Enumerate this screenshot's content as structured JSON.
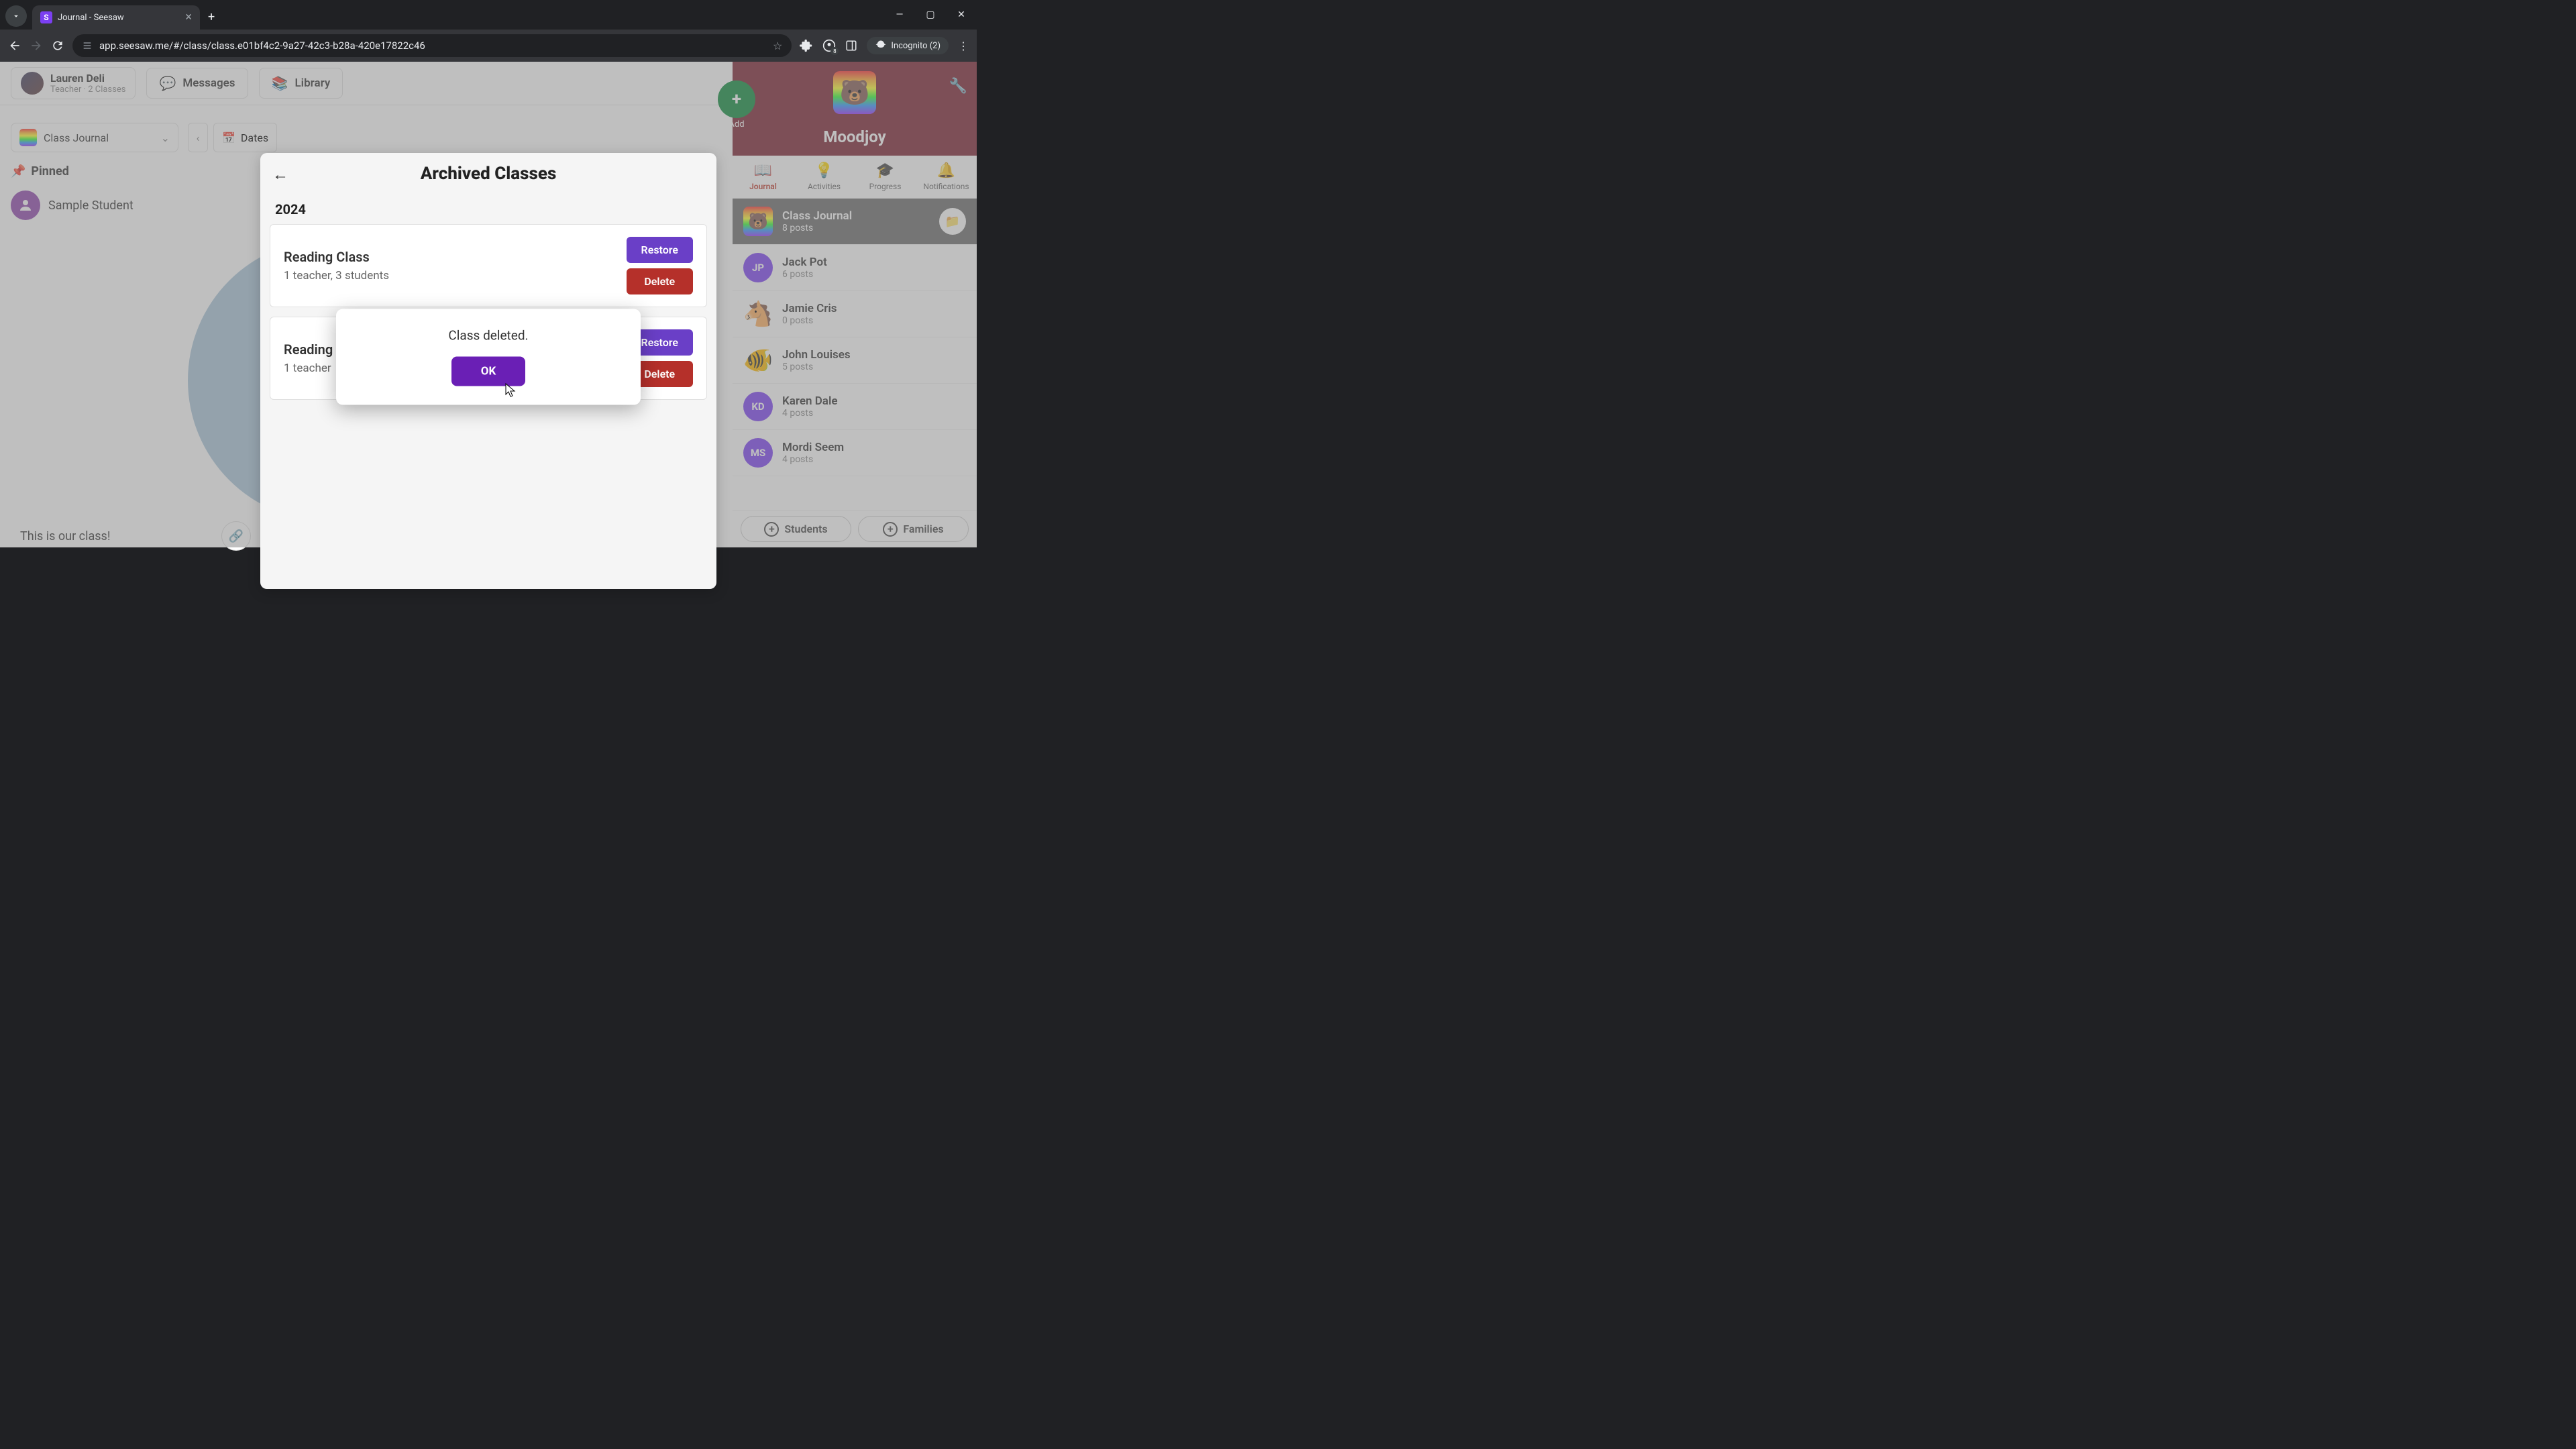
{
  "browser": {
    "tab_title": "Journal - Seesaw",
    "url": "app.seesaw.me/#/class/class.e01bf4c2-9a27-42c3-b28a-420e17822c46",
    "incognito_label": "Incognito (2)"
  },
  "header": {
    "user_name": "Lauren Deli",
    "user_role": "Teacher · 2 Classes",
    "messages_label": "Messages",
    "library_label": "Library"
  },
  "left": {
    "journal_label": "Class Journal",
    "dates_label": "Dates",
    "pinned_label": "Pinned",
    "sample_student": "Sample Student",
    "bottom_text": "This is our class!"
  },
  "right": {
    "add_label": "Add",
    "class_name": "Moodjoy",
    "tabs": {
      "journal": "Journal",
      "activities": "Activities",
      "progress": "Progress",
      "notifications": "Notifications"
    },
    "items": [
      {
        "title": "Class Journal",
        "sub": "8 posts",
        "avatar": "rainbow",
        "selected": true,
        "folder": true
      },
      {
        "title": "Jack Pot",
        "sub": "6 posts",
        "avatar": "jp",
        "initials": "JP"
      },
      {
        "title": "Jamie Cris",
        "sub": "0 posts",
        "avatar": "horse"
      },
      {
        "title": "John Louises",
        "sub": "5 posts",
        "avatar": "fish"
      },
      {
        "title": "Karen Dale",
        "sub": "4 posts",
        "avatar": "kd",
        "initials": "KD"
      },
      {
        "title": "Mordi Seem",
        "sub": "4 posts",
        "avatar": "ms",
        "initials": "MS"
      }
    ],
    "students_label": "Students",
    "families_label": "Families"
  },
  "archived": {
    "title": "Archived Classes",
    "year": "2024",
    "classes": [
      {
        "title": "Reading Class",
        "sub": "1 teacher, 3 students"
      },
      {
        "title": "Reading",
        "sub": "1 teacher"
      }
    ],
    "restore_label": "Restore",
    "delete_label": "Delete"
  },
  "confirm": {
    "message": "Class deleted.",
    "ok_label": "OK"
  }
}
